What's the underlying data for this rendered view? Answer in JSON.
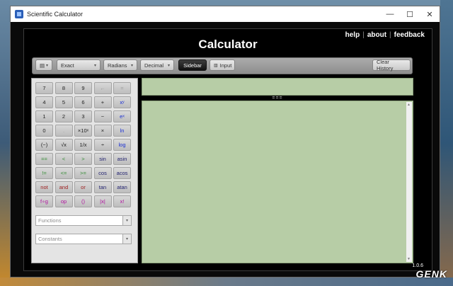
{
  "window": {
    "title": "Scientific Calculator",
    "minimize": "—",
    "maximize": "☐",
    "close": "✕"
  },
  "header": {
    "links": [
      "help",
      "about",
      "feedback"
    ],
    "separator": "|",
    "title": "Calculator"
  },
  "toolbar": {
    "menu_label": "▤",
    "mode": "Exact",
    "angle": "Radians",
    "format": "Decimal",
    "sidebar": "Sidebar",
    "input": "Input",
    "clear_history": "Clear History",
    "caret": "▾"
  },
  "keypad": {
    "rows": [
      [
        "7",
        "8",
        "9",
        "←",
        "="
      ],
      [
        "4",
        "5",
        "6",
        "+",
        "xʸ"
      ],
      [
        "1",
        "2",
        "3",
        "−",
        "eˣ"
      ],
      [
        "0",
        ".",
        "×10ˣ",
        "×",
        "ln"
      ],
      [
        "(−)",
        "√x",
        "1/x",
        "÷",
        "log"
      ],
      [
        "==",
        "<",
        ">",
        "sin",
        "asin"
      ],
      [
        "!=",
        "<=",
        ">=",
        "cos",
        "acos"
      ],
      [
        "not",
        "and",
        "or",
        "tan",
        "atan"
      ],
      [
        "f∘g",
        "op",
        "()",
        "|x|",
        "x!"
      ]
    ]
  },
  "sidebar": {
    "functions_placeholder": "Functions",
    "constants_placeholder": "Constants"
  },
  "history": {
    "splitter": "==="
  },
  "footer": {
    "version": "1.0.6"
  },
  "watermark": "GENK",
  "colors": {
    "history_bg": "#b7cda6",
    "key_blue": "#1a2fd4",
    "key_green": "#2f8a2f",
    "key_red": "#a12323",
    "key_navy": "#222270",
    "key_magenta": "#b0139f"
  }
}
